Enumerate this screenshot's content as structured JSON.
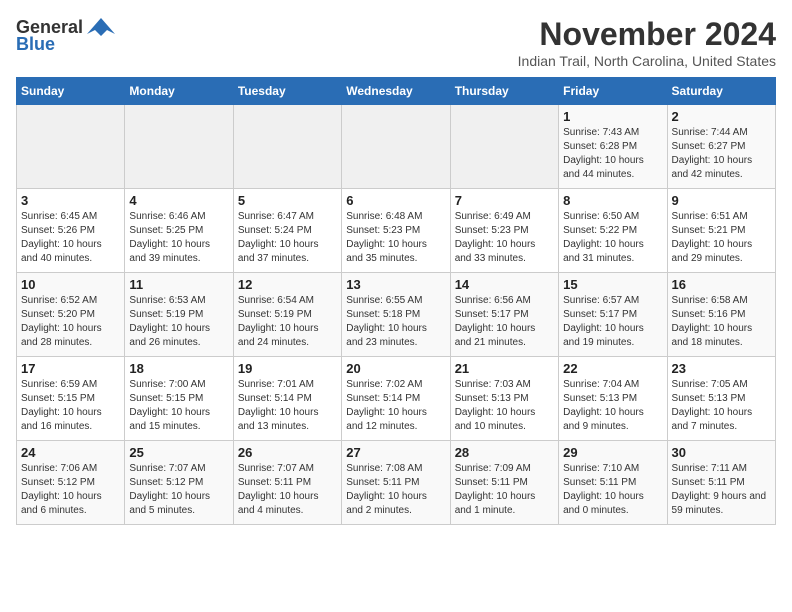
{
  "logo": {
    "general": "General",
    "blue": "Blue"
  },
  "header": {
    "month": "November 2024",
    "location": "Indian Trail, North Carolina, United States"
  },
  "weekdays": [
    "Sunday",
    "Monday",
    "Tuesday",
    "Wednesday",
    "Thursday",
    "Friday",
    "Saturday"
  ],
  "weeks": [
    [
      {
        "day": "",
        "info": ""
      },
      {
        "day": "",
        "info": ""
      },
      {
        "day": "",
        "info": ""
      },
      {
        "day": "",
        "info": ""
      },
      {
        "day": "",
        "info": ""
      },
      {
        "day": "1",
        "info": "Sunrise: 7:43 AM\nSunset: 6:28 PM\nDaylight: 10 hours and 44 minutes."
      },
      {
        "day": "2",
        "info": "Sunrise: 7:44 AM\nSunset: 6:27 PM\nDaylight: 10 hours and 42 minutes."
      }
    ],
    [
      {
        "day": "3",
        "info": "Sunrise: 6:45 AM\nSunset: 5:26 PM\nDaylight: 10 hours and 40 minutes."
      },
      {
        "day": "4",
        "info": "Sunrise: 6:46 AM\nSunset: 5:25 PM\nDaylight: 10 hours and 39 minutes."
      },
      {
        "day": "5",
        "info": "Sunrise: 6:47 AM\nSunset: 5:24 PM\nDaylight: 10 hours and 37 minutes."
      },
      {
        "day": "6",
        "info": "Sunrise: 6:48 AM\nSunset: 5:23 PM\nDaylight: 10 hours and 35 minutes."
      },
      {
        "day": "7",
        "info": "Sunrise: 6:49 AM\nSunset: 5:23 PM\nDaylight: 10 hours and 33 minutes."
      },
      {
        "day": "8",
        "info": "Sunrise: 6:50 AM\nSunset: 5:22 PM\nDaylight: 10 hours and 31 minutes."
      },
      {
        "day": "9",
        "info": "Sunrise: 6:51 AM\nSunset: 5:21 PM\nDaylight: 10 hours and 29 minutes."
      }
    ],
    [
      {
        "day": "10",
        "info": "Sunrise: 6:52 AM\nSunset: 5:20 PM\nDaylight: 10 hours and 28 minutes."
      },
      {
        "day": "11",
        "info": "Sunrise: 6:53 AM\nSunset: 5:19 PM\nDaylight: 10 hours and 26 minutes."
      },
      {
        "day": "12",
        "info": "Sunrise: 6:54 AM\nSunset: 5:19 PM\nDaylight: 10 hours and 24 minutes."
      },
      {
        "day": "13",
        "info": "Sunrise: 6:55 AM\nSunset: 5:18 PM\nDaylight: 10 hours and 23 minutes."
      },
      {
        "day": "14",
        "info": "Sunrise: 6:56 AM\nSunset: 5:17 PM\nDaylight: 10 hours and 21 minutes."
      },
      {
        "day": "15",
        "info": "Sunrise: 6:57 AM\nSunset: 5:17 PM\nDaylight: 10 hours and 19 minutes."
      },
      {
        "day": "16",
        "info": "Sunrise: 6:58 AM\nSunset: 5:16 PM\nDaylight: 10 hours and 18 minutes."
      }
    ],
    [
      {
        "day": "17",
        "info": "Sunrise: 6:59 AM\nSunset: 5:15 PM\nDaylight: 10 hours and 16 minutes."
      },
      {
        "day": "18",
        "info": "Sunrise: 7:00 AM\nSunset: 5:15 PM\nDaylight: 10 hours and 15 minutes."
      },
      {
        "day": "19",
        "info": "Sunrise: 7:01 AM\nSunset: 5:14 PM\nDaylight: 10 hours and 13 minutes."
      },
      {
        "day": "20",
        "info": "Sunrise: 7:02 AM\nSunset: 5:14 PM\nDaylight: 10 hours and 12 minutes."
      },
      {
        "day": "21",
        "info": "Sunrise: 7:03 AM\nSunset: 5:13 PM\nDaylight: 10 hours and 10 minutes."
      },
      {
        "day": "22",
        "info": "Sunrise: 7:04 AM\nSunset: 5:13 PM\nDaylight: 10 hours and 9 minutes."
      },
      {
        "day": "23",
        "info": "Sunrise: 7:05 AM\nSunset: 5:13 PM\nDaylight: 10 hours and 7 minutes."
      }
    ],
    [
      {
        "day": "24",
        "info": "Sunrise: 7:06 AM\nSunset: 5:12 PM\nDaylight: 10 hours and 6 minutes."
      },
      {
        "day": "25",
        "info": "Sunrise: 7:07 AM\nSunset: 5:12 PM\nDaylight: 10 hours and 5 minutes."
      },
      {
        "day": "26",
        "info": "Sunrise: 7:07 AM\nSunset: 5:11 PM\nDaylight: 10 hours and 4 minutes."
      },
      {
        "day": "27",
        "info": "Sunrise: 7:08 AM\nSunset: 5:11 PM\nDaylight: 10 hours and 2 minutes."
      },
      {
        "day": "28",
        "info": "Sunrise: 7:09 AM\nSunset: 5:11 PM\nDaylight: 10 hours and 1 minute."
      },
      {
        "day": "29",
        "info": "Sunrise: 7:10 AM\nSunset: 5:11 PM\nDaylight: 10 hours and 0 minutes."
      },
      {
        "day": "30",
        "info": "Sunrise: 7:11 AM\nSunset: 5:11 PM\nDaylight: 9 hours and 59 minutes."
      }
    ]
  ]
}
